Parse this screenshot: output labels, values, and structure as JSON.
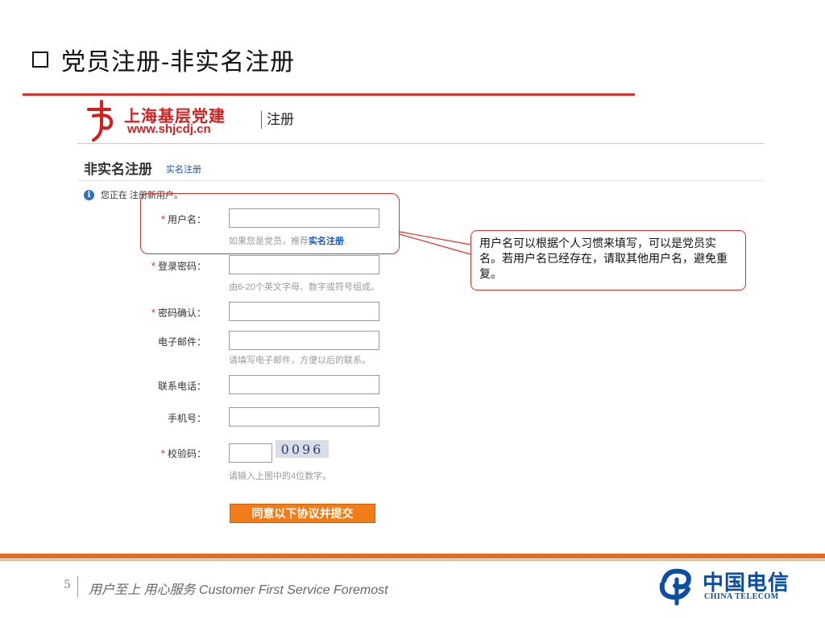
{
  "slide": {
    "title": "党员注册-非实名注册",
    "page_number": "5",
    "slogan": "用户至上 用心服务 Customer First Service Foremost"
  },
  "header": {
    "logo_cn": "上海基层党建",
    "logo_url": "www.shjcdj.cn",
    "title": "注册"
  },
  "form": {
    "heading": "非实名注册",
    "alt_link": "实名注册",
    "info_text": "您正在 注册新用户。",
    "required_mark": "*",
    "fields": {
      "username": {
        "label": "用户名：",
        "value": "",
        "hint_prefix": "如果您是党员，推荐",
        "hint_link": "实名注册",
        "hint_suffix": "."
      },
      "password": {
        "label": "登录密码：",
        "value": "",
        "hint": "由6-20个英文字母、数字或符号组成。"
      },
      "password_confirm": {
        "label": "密码确认：",
        "value": ""
      },
      "email": {
        "label": "电子邮件：",
        "value": "",
        "hint": "请填写电子邮件，方便以后的联系。"
      },
      "phone": {
        "label": "联系电话：",
        "value": ""
      },
      "mobile": {
        "label": "手机号：",
        "value": ""
      },
      "captcha": {
        "label": "校验码：",
        "value": "",
        "image_text": "0096",
        "hint": "请输入上图中的4位数字。"
      }
    },
    "submit_label": "同意以下协议并提交"
  },
  "callout": {
    "text": "用户名可以根据个人习惯来填写，可以是党员实名。若用户名已经存在，请取其他用户名，避免重复。"
  },
  "brand": {
    "cn": "中国电信",
    "en": "CHINA TELECOM"
  },
  "colors": {
    "accent_red": "#e0302a",
    "footer_orange": "#e86a1c",
    "link_blue": "#1654c8",
    "button_orange": "#f07d1a",
    "brand_blue": "#0b4ea2"
  }
}
